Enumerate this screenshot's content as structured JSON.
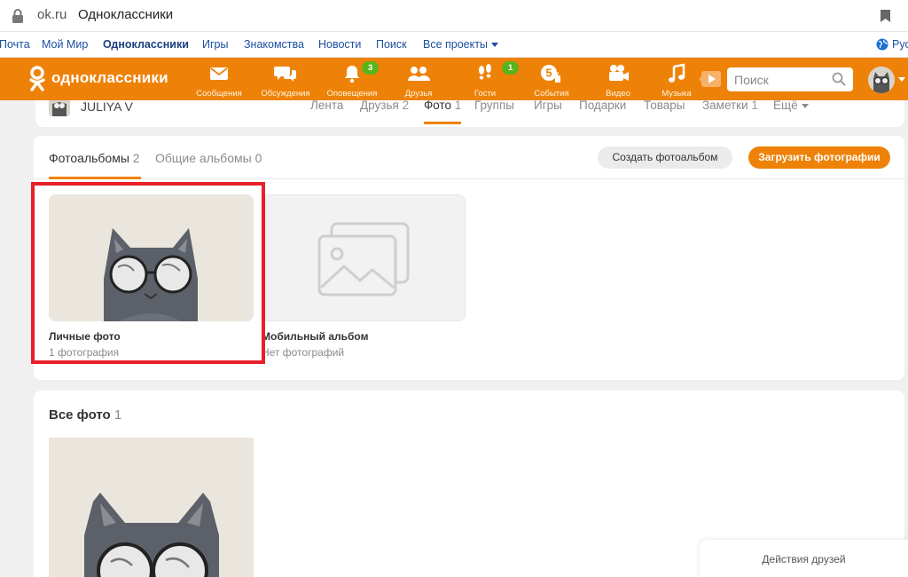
{
  "browser": {
    "domain": "ok.ru",
    "title": "Одноклассники"
  },
  "toplinks": {
    "items": [
      "Почта",
      "Мой Мир",
      "Одноклассники",
      "Игры",
      "Знакомства",
      "Новости",
      "Поиск",
      "Все проекты"
    ],
    "lang": "Рус"
  },
  "toolbar": {
    "brand": "одноклассники",
    "nav": [
      {
        "label": "Сообщения",
        "icon": "envelope-icon"
      },
      {
        "label": "Обсуждения",
        "icon": "chat-bubbles-icon"
      },
      {
        "label": "Оповещения",
        "icon": "bell-icon",
        "badge": "3"
      },
      {
        "label": "Друзья",
        "icon": "friends-icon"
      },
      {
        "label": "Гости",
        "icon": "footprints-icon",
        "badge": "1"
      },
      {
        "label": "События",
        "icon": "events-five-icon"
      },
      {
        "label": "Видео",
        "icon": "video-camera-icon"
      },
      {
        "label": "Музыка",
        "icon": "music-note-icon"
      }
    ],
    "search_placeholder": "Поиск"
  },
  "profile": {
    "name": "JULIYA V",
    "tabs": [
      {
        "label": "Лента",
        "count": ""
      },
      {
        "label": "Друзья",
        "count": "2"
      },
      {
        "label": "Фото",
        "count": "1"
      },
      {
        "label": "Группы",
        "count": ""
      },
      {
        "label": "Игры",
        "count": ""
      },
      {
        "label": "Подарки",
        "count": ""
      },
      {
        "label": "Товары",
        "count": ""
      },
      {
        "label": "Заметки",
        "count": "1"
      },
      {
        "label": "Ещё",
        "count": ""
      }
    ]
  },
  "albums": {
    "tab_albums": "Фотоальбомы",
    "tab_albums_count": "2",
    "tab_shared": "Общие альбомы",
    "tab_shared_count": "0",
    "create_button": "Создать фотоальбом",
    "upload_button": "Загрузить фотографии",
    "items": [
      {
        "title": "Личные фото",
        "subtitle": "1 фотография"
      },
      {
        "title": "Мобильный альбом",
        "subtitle": "Нет фотографий"
      }
    ]
  },
  "all_photos": {
    "heading": "Все фото",
    "count": "1"
  },
  "friends_panel": {
    "label": "Действия друзей"
  },
  "colors": {
    "brand_orange": "#ee8208",
    "highlight_red": "#e8202a",
    "badge_green": "#5ab31a"
  }
}
